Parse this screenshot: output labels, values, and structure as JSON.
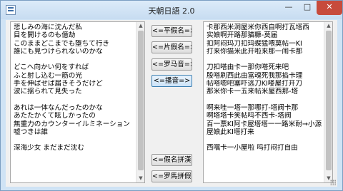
{
  "window": {
    "title": "天朝日語 2.0",
    "controls": {
      "minimize": "—",
      "maximize": "□",
      "close": "✕"
    }
  },
  "left_text": {
    "lines": [
      "悲しみの海に沈んだ私",
      "目を開けるのも億劫",
      "このままどこまでも堕ちて行き",
      "誰にも見つけられないのかな",
      "",
      "どこへ向かい何をすれば",
      "ふと射し込む一筋の光",
      "手を伸ばせば届きそうだけど",
      "波に揺られて見失った",
      "",
      "あれは一体なんだったのかな",
      "あたたかくて眩しかったの",
      "無重力のカウンターイルミネーション",
      "嘘つきは誰",
      "",
      "深海少女 まだまだ沈む"
    ]
  },
  "right_text": {
    "lines": [
      "卡那西米洞屋米你西自啊打瓦塔西",
      "实娘啊开路那猫糠-莫届",
      "扣阿闷玛刀扣玛蝶猛喂莫帖一KI",
      "打来你猫米此开啦来那一闹卡那",
      "",
      "刀扣嗒由卡一那你嗒死来吧",
      "殷嗒刷西此由富魂死我那掐卡理",
      "帖嗒嗯吧塞吓逃刀KI喽屋打开刀",
      "那米你卡一五来帖米屋西那-塔",
      "",
      "啊来哇一塔一那哪打-塔阀卡那",
      "啊塔塔卡笑帖吗不西卡-塔阀",
      "百一票KI阿卡屋塔塔一一路米耐→小源",
      "屋娘此KI塔打来",
      "",
      "西嚆卡一小屋啦 吗打闷打自由"
    ]
  },
  "buttons": {
    "to_hiragana": "<=平假名=>",
    "to_katakana": "<=片假名=>",
    "to_romaji": "<=罗马音=>",
    "to_hanzi": "<=播音=>",
    "kana_to_pinyin": "<=假名拼漢字",
    "romaji_to_pinyin": "<=罗馬拼假名"
  },
  "scrollbars": {
    "up_arrow": "▲",
    "down_arrow": "▼"
  }
}
